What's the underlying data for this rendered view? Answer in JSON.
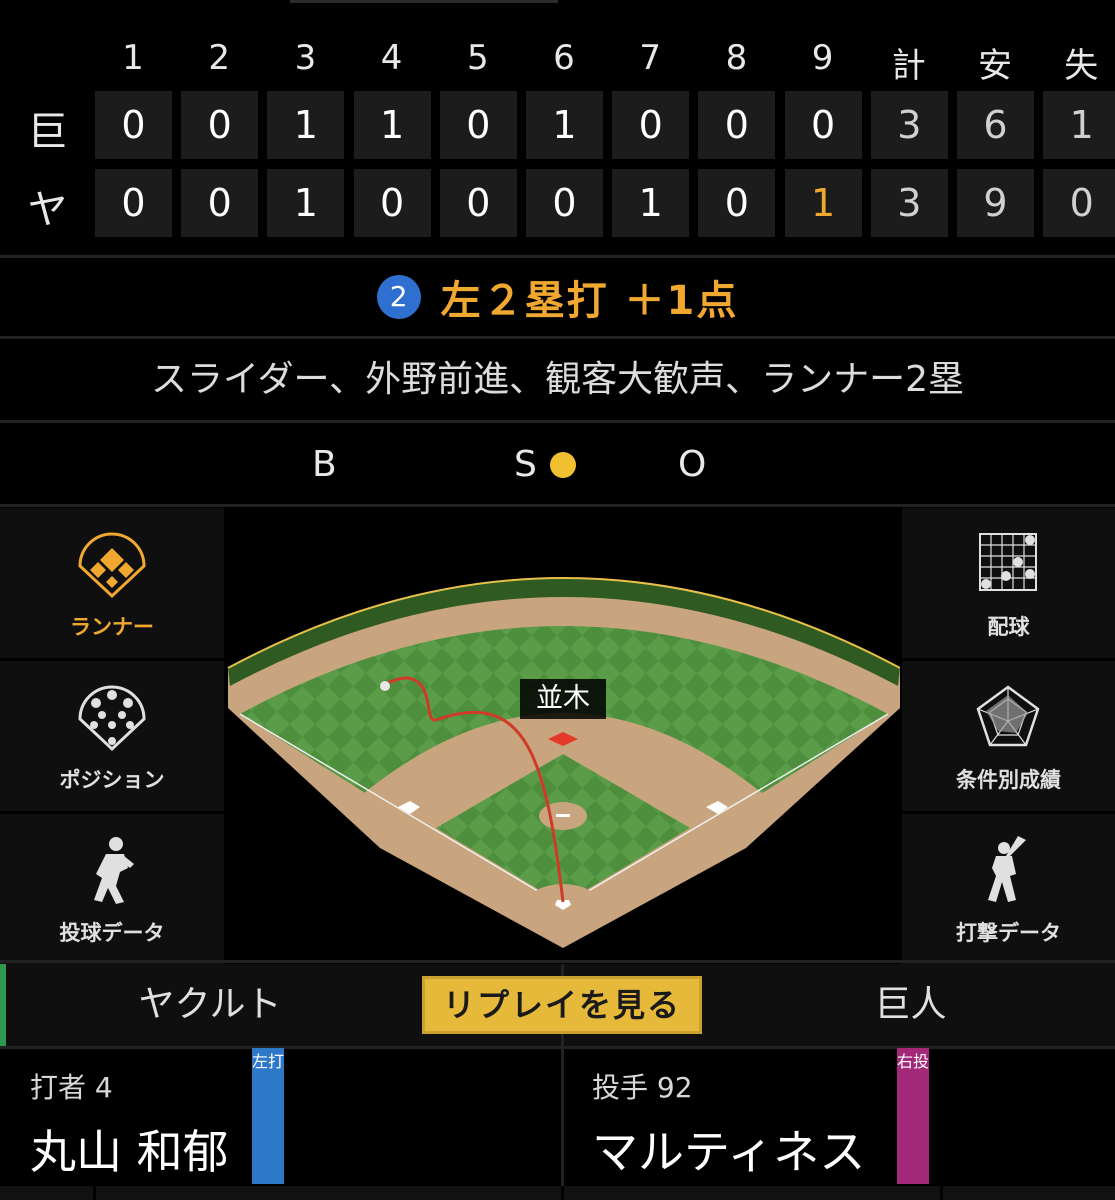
{
  "scoreboard": {
    "headers": [
      "1",
      "2",
      "3",
      "4",
      "5",
      "6",
      "7",
      "8",
      "9",
      "計",
      "安",
      "失"
    ],
    "rows": [
      {
        "team": "巨",
        "cells": [
          "0",
          "0",
          "1",
          "1",
          "0",
          "1",
          "0",
          "0",
          "0",
          "3",
          "6",
          "1"
        ]
      },
      {
        "team": "ヤ",
        "cells": [
          "0",
          "0",
          "1",
          "0",
          "0",
          "0",
          "1",
          "0",
          "1",
          "3",
          "9",
          "0"
        ]
      }
    ]
  },
  "play": {
    "number": "2",
    "result": "左２塁打 ＋1点",
    "description": "スライダー、外野前進、観客大歓声、ランナー2塁"
  },
  "count": {
    "ball_label": "B",
    "strike_label": "S",
    "out_label": "O",
    "balls": 0,
    "strikes": 1,
    "outs": 0,
    "strike_color": "#f0c030"
  },
  "menu_left": [
    {
      "label": "ランナー",
      "icon": "runner-diamond-icon",
      "active": true
    },
    {
      "label": "ポジション",
      "icon": "position-icon",
      "active": false
    },
    {
      "label": "投球データ",
      "icon": "pitcher-icon",
      "active": false
    }
  ],
  "menu_right": [
    {
      "label": "配球",
      "icon": "pitch-grid-icon"
    },
    {
      "label": "条件別成績",
      "icon": "radar-chart-icon"
    },
    {
      "label": "打撃データ",
      "icon": "batter-icon"
    }
  ],
  "field": {
    "fielder_label": "並木"
  },
  "tabs": {
    "left": "ヤクルト",
    "replay": "リプレイを見る",
    "right": "巨人"
  },
  "batter": {
    "role": "打者 4",
    "name": "丸山 和郁",
    "badge": "左打",
    "badge_color": "#2e78c8"
  },
  "pitcher": {
    "role": "投手 92",
    "name": "マルティネス",
    "badge": "右投",
    "badge_color": "#a3287a"
  },
  "colors": {
    "accent": "#f0a830",
    "team_accent": "#2e9a4e"
  }
}
